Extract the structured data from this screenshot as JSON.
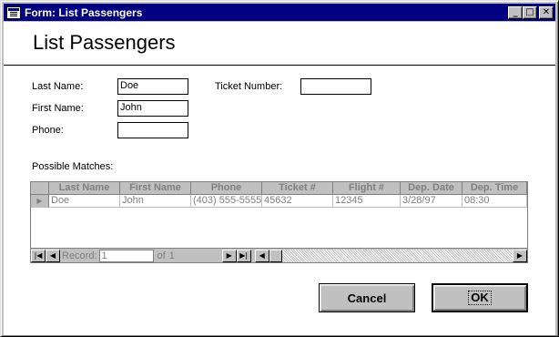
{
  "window": {
    "title": "Form: List Passengers"
  },
  "titlebar_buttons": {
    "minimize": "_",
    "maximize": "□",
    "close": "✕"
  },
  "header": {
    "title": "List Passengers"
  },
  "form": {
    "last_name_label": "Last Name:",
    "last_name_value": "Doe",
    "first_name_label": "First Name:",
    "first_name_value": "John",
    "phone_label": "Phone:",
    "phone_value": "",
    "ticket_label": "Ticket Number:",
    "ticket_value": ""
  },
  "matches": {
    "label": "Possible Matches:",
    "columns": [
      "Last Name",
      "First Name",
      "Phone",
      "Ticket #",
      "Flight #",
      "Dep. Date",
      "Dep. Time"
    ],
    "rows": [
      [
        "Doe",
        "John",
        "(403) 555-5555",
        "45632",
        "12345",
        "3/28/97",
        "08:30"
      ]
    ],
    "row_selector": "▶"
  },
  "navigator": {
    "record_label": "Record:",
    "current": "1",
    "of_label": "of",
    "total": "1"
  },
  "buttons": {
    "cancel": "Cancel",
    "ok": "OK"
  },
  "colors": {
    "titlebar": "#000080",
    "face": "#c0c0c0"
  },
  "icons": [
    "form-app-icon",
    "minimize-icon",
    "maximize-icon",
    "close-icon",
    "first-record-icon",
    "prev-record-icon",
    "next-record-icon",
    "last-record-icon",
    "scroll-left-icon",
    "scroll-right-icon"
  ]
}
